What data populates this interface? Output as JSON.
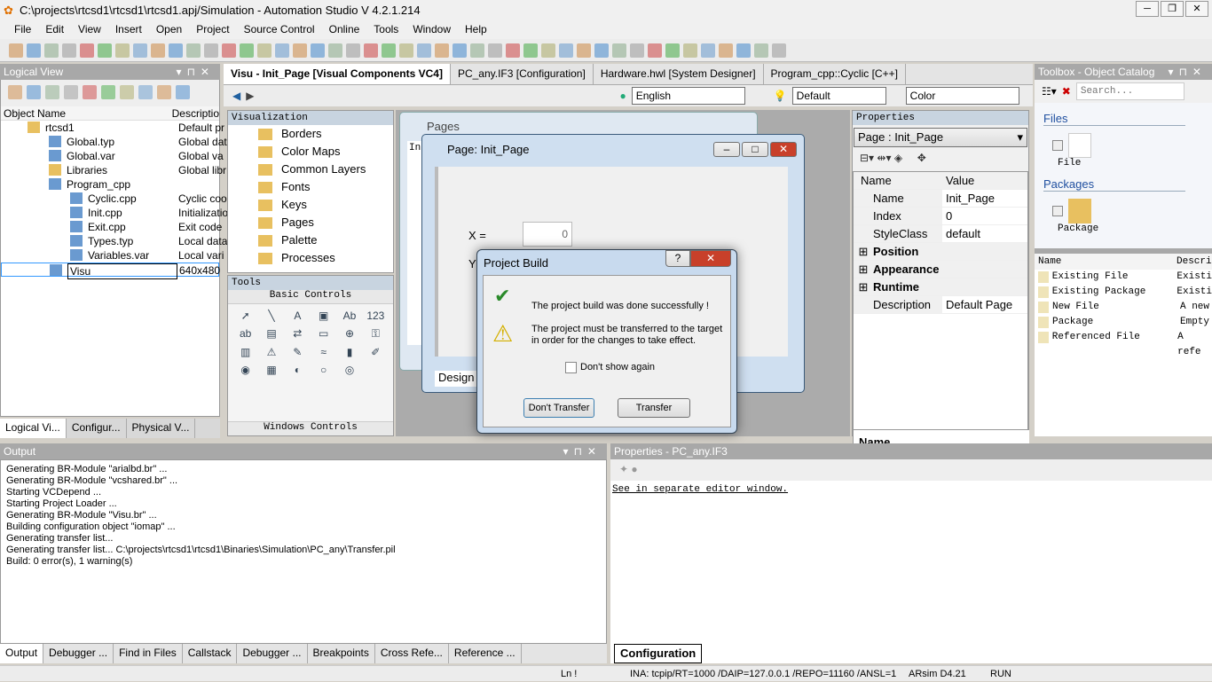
{
  "window": {
    "title": "C:\\projects\\rtcsd1\\rtcsd1\\rtcsd1.apj/Simulation - Automation Studio V 4.2.1.214"
  },
  "menu": [
    "File",
    "Edit",
    "View",
    "Insert",
    "Open",
    "Project",
    "Source Control",
    "Online",
    "Tools",
    "Window",
    "Help"
  ],
  "logical_view": {
    "title": "Logical View",
    "columns": [
      "Object Name",
      "Descriptio"
    ],
    "items": [
      {
        "name": "rtcsd1",
        "desc": "Default pr",
        "level": 0,
        "icon": "folder-icon"
      },
      {
        "name": "Global.typ",
        "desc": "Global dat",
        "level": 1,
        "icon": "datatype-icon"
      },
      {
        "name": "Global.var",
        "desc": "Global va",
        "level": 1,
        "icon": "variable-icon"
      },
      {
        "name": "Libraries",
        "desc": "Global libr",
        "level": 1,
        "icon": "folder-icon"
      },
      {
        "name": "Program_cpp",
        "desc": "",
        "level": 1,
        "icon": "program-icon"
      },
      {
        "name": "Cyclic.cpp",
        "desc": "Cyclic coo",
        "level": 2,
        "icon": "cpp-file-icon"
      },
      {
        "name": "Init.cpp",
        "desc": "Initializatio",
        "level": 2,
        "icon": "cpp-file-icon"
      },
      {
        "name": "Exit.cpp",
        "desc": "Exit code",
        "level": 2,
        "icon": "cpp-file-icon"
      },
      {
        "name": "Types.typ",
        "desc": "Local data",
        "level": 2,
        "icon": "datatype-icon"
      },
      {
        "name": "Variables.var",
        "desc": "Local vari",
        "level": 2,
        "icon": "variable-icon"
      },
      {
        "name": "Visu",
        "desc": "640x480",
        "level": 1,
        "icon": "visu-icon"
      }
    ],
    "tabs": [
      "Logical Vi...",
      "Configur...",
      "Physical V..."
    ]
  },
  "editor_tabs": [
    "Visu - Init_Page [Visual Components VC4]",
    "PC_any.IF3 [Configuration]",
    "Hardware.hwl [System Designer]",
    "Program_cpp::Cyclic [C++]"
  ],
  "editor_toolbar": {
    "language": "English",
    "style": "Default",
    "color": "Color"
  },
  "visualization": {
    "title": "Visualization",
    "items": [
      "Borders",
      "Color Maps",
      "Common Layers",
      "Fonts",
      "Keys",
      "Pages",
      "Palette",
      "Processes"
    ]
  },
  "tools": {
    "title": "Tools",
    "group": "Basic Controls",
    "footer": "Windows Controls"
  },
  "pages_window": {
    "title": "Pages",
    "col": "Ind"
  },
  "page_window": {
    "title": "Page: Init_Page",
    "x_label": "X =",
    "x_value": "0",
    "y_label": "Y",
    "tab": "Design"
  },
  "dialog": {
    "title": "Project Build",
    "msg1": "The project build was done successfully !",
    "msg2": "The project must be transferred to the target in order for the changes to take effect.",
    "checkbox": "Don't show again",
    "btn_no": "Don't Transfer",
    "btn_yes": "Transfer",
    "help": "?"
  },
  "properties": {
    "title": "Properties",
    "selector": "Page : Init_Page",
    "columns": [
      "Name",
      "Value"
    ],
    "rows": [
      {
        "name": "Name",
        "value": "Init_Page"
      },
      {
        "name": "Index",
        "value": "0"
      },
      {
        "name": "StyleClass",
        "value": "default"
      }
    ],
    "groups": [
      "Position",
      "Appearance",
      "Runtime"
    ],
    "description": {
      "name": "Description",
      "value": "Default Page"
    },
    "footer": "Name"
  },
  "toolbox": {
    "title": "Toolbox - Object Catalog",
    "search_placeholder": "Search...",
    "sections": [
      {
        "title": "Files",
        "item": "File"
      },
      {
        "title": "Packages",
        "item": "Package"
      }
    ],
    "columns": [
      "Name",
      "Descri"
    ],
    "list": [
      {
        "name": "Existing File",
        "desc": "Existi"
      },
      {
        "name": "Existing Package",
        "desc": "Existi"
      },
      {
        "name": "New File",
        "desc": "A new"
      },
      {
        "name": "Package",
        "desc": "Empty"
      },
      {
        "name": "Referenced File",
        "desc": "A refe"
      }
    ]
  },
  "output": {
    "title": "Output",
    "lines": [
      "Generating BR-Module \"arialbd.br\" ...",
      "Generating BR-Module \"vcshared.br\" ...",
      "Starting VCDepend ...",
      "Starting Project Loader ...",
      "Generating BR-Module \"Visu.br\" ...",
      "Building configuration object \"iomap\" ...",
      "Generating transfer list...",
      "Generating transfer list... C:\\projects\\rtcsd1\\rtcsd1\\Binaries\\Simulation\\PC_any\\Transfer.pil",
      "Build: 0 error(s), 1 warning(s)"
    ],
    "tabs": [
      "Output",
      "Debugger ...",
      "Find in Files",
      "Callstack",
      "Debugger ...",
      "Breakpoints",
      "Cross Refe...",
      "Reference ..."
    ]
  },
  "props_pc": {
    "title": "Properties - PC_any.IF3",
    "link": "See in separate editor window.",
    "tab": "Configuration"
  },
  "status": {
    "ln": "Ln !",
    "connection": "INA: tcpip/RT=1000 /DAIP=127.0.0.1 /REPO=11160 /ANSL=1",
    "target": "ARsim  D4.21",
    "state": "RUN"
  }
}
